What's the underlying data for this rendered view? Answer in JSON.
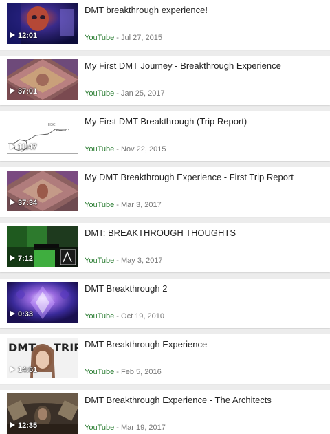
{
  "results": [
    {
      "title": "DMT breakthrough experience!",
      "duration": "12:01",
      "source": "YouTube",
      "separator": " - ",
      "date": "Jul 27, 2015",
      "thumbnail_icon": "video-thumbnail-icon"
    },
    {
      "title": "My First DMT Journey - Breakthrough Experience",
      "duration": "37:01",
      "source": "YouTube",
      "separator": " - ",
      "date": "Jan 25, 2017",
      "thumbnail_icon": "video-thumbnail-icon"
    },
    {
      "title": "My First DMT Breakthrough (Trip Report)",
      "duration": "11:47",
      "source": "YouTube",
      "separator": " - ",
      "date": "Nov 22, 2015",
      "thumbnail_icon": "video-thumbnail-icon"
    },
    {
      "title": "My DMT Breakthrough Experience - First Trip Report",
      "duration": "37:34",
      "source": "YouTube",
      "separator": " - ",
      "date": "Mar 3, 2017",
      "thumbnail_icon": "video-thumbnail-icon"
    },
    {
      "title": "DMT: BREAKTHROUGH THOUGHTS",
      "duration": "7:12",
      "source": "YouTube",
      "separator": " - ",
      "date": "May 3, 2017",
      "thumbnail_icon": "video-thumbnail-icon"
    },
    {
      "title": "DMT Breakthrough 2",
      "duration": "0:33",
      "source": "YouTube",
      "separator": " - ",
      "date": "Oct 19, 2010",
      "thumbnail_icon": "video-thumbnail-icon"
    },
    {
      "title": "DMT Breakthrough Experience",
      "duration": "14:51",
      "source": "YouTube",
      "separator": " - ",
      "date": "Feb 5, 2016",
      "thumbnail_icon": "video-thumbnail-icon"
    },
    {
      "title": "DMT Breakthrough Experience - The Architects",
      "duration": "12:35",
      "source": "YouTube",
      "separator": " - ",
      "date": "Mar 19, 2017",
      "thumbnail_icon": "video-thumbnail-icon"
    }
  ],
  "thumbnail_text": {
    "r2_h3c": "H3C",
    "r2_ch3": "N—CH3",
    "r6_dmt": "DMT",
    "r6_trip": "TRIP"
  },
  "colors": {
    "background": "#ececec",
    "card": "#ffffff",
    "title": "#222222",
    "source": "#2a7d32",
    "meta": "#777777"
  }
}
